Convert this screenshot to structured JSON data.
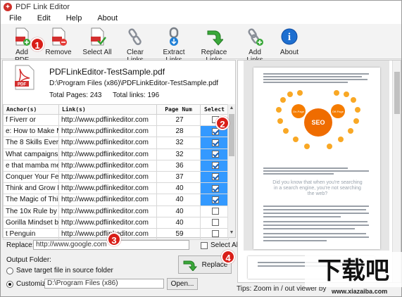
{
  "window": {
    "title": "PDF Link Editor"
  },
  "menu": [
    "File",
    "Edit",
    "Help",
    "About"
  ],
  "toolbar": [
    {
      "label": "Add PDF",
      "icon": "add-pdf-icon"
    },
    {
      "label": "Remove",
      "icon": "remove-pdf-icon"
    },
    {
      "label": "Select All",
      "icon": "select-all-icon"
    },
    {
      "label": "Clear Links",
      "icon": "clear-links-icon"
    },
    {
      "label": "Extract Links",
      "icon": "extract-links-icon"
    },
    {
      "label": "Replace Links",
      "icon": "replace-links-icon"
    },
    {
      "label": "Add Links",
      "icon": "add-links-icon"
    },
    {
      "label": "About",
      "icon": "about-icon"
    }
  ],
  "callouts": [
    "1",
    "2",
    "3",
    "4"
  ],
  "file": {
    "name": "PDFLinkEditor-TestSample.pdf",
    "path": "D:\\Program Files (x86)\\PDFLinkEditor-TestSample.pdf",
    "total_pages": "Total Pages: 243",
    "total_links": "Total links: 196"
  },
  "table": {
    "headers": [
      "Anchor(s)",
      "Link(s)",
      "Page Num",
      "Select"
    ],
    "rows": [
      {
        "anchor": "f Fiverr or",
        "link": "http://www.pdflinkeditor.com",
        "page": "27",
        "checked": false,
        "highlight": false
      },
      {
        "anchor": "e: How to Make M...",
        "link": "http://www.pdflinkeditor.com",
        "page": "28",
        "checked": true,
        "highlight": true
      },
      {
        "anchor": "The 8 Skills Every S...",
        "link": "http://www.pdflinkeditor.com",
        "page": "32",
        "checked": true,
        "highlight": true
      },
      {
        "anchor": "What campaigns c...",
        "link": "http://www.pdflinkeditor.com",
        "page": "32",
        "checked": true,
        "highlight": true
      },
      {
        "anchor": "e that mamba me...",
        "link": "http://www.pdflinkeditor.com",
        "page": "36",
        "checked": true,
        "highlight": true
      },
      {
        "anchor": "Conquer Your Fear...",
        "link": "http://www.pdflinkeditor.com",
        "page": "37",
        "checked": true,
        "highlight": true
      },
      {
        "anchor": "Think and Grow Ri...",
        "link": "http://www.pdflinkeditor.com",
        "page": "40",
        "checked": true,
        "highlight": true
      },
      {
        "anchor": "The Magic of Thin...",
        "link": "http://www.pdflinkeditor.com",
        "page": "40",
        "checked": true,
        "highlight": true
      },
      {
        "anchor": "The 10x Rule by Gr...",
        "link": "http://www.pdflinkeditor.com",
        "page": "40",
        "checked": false,
        "highlight": false
      },
      {
        "anchor": "Gorilla Mindset by...",
        "link": "http://www.pdflinkeditor.com",
        "page": "40",
        "checked": false,
        "highlight": false
      },
      {
        "anchor": "t Penguin",
        "link": "http://www.pdflinkeditor.com",
        "page": "59",
        "checked": false,
        "highlight": false
      }
    ]
  },
  "replace": {
    "label": "Replace:",
    "value": "http://www.google.com",
    "select_all": "Select All",
    "button": "Replace"
  },
  "output": {
    "label": "Output Folder:",
    "opt_source": "Save target file in source folder",
    "opt_custom": "Customize:",
    "custom_path": "D:\\Program Files (x86)",
    "open": "Open..."
  },
  "preview": {
    "seo_center": "SEO",
    "seo_left": "On-Page",
    "seo_right": "Off-Page",
    "quote": "Did you know that when you're searching in a search engine, you're not searching the web?"
  },
  "tips": "Tips: Zoom in / out viewer by",
  "watermark": {
    "text": "www.xiazaiba.com",
    "glyph": "下载吧"
  }
}
